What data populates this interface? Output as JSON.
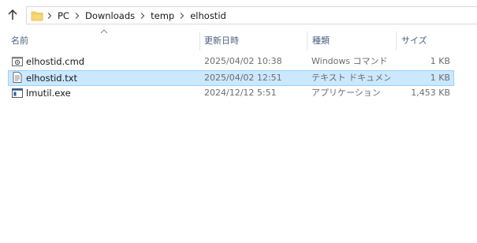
{
  "address_bar": {
    "crumbs": [
      "PC",
      "Downloads",
      "temp",
      "elhostid"
    ]
  },
  "columns": {
    "name": "名前",
    "date": "更新日時",
    "type": "種類",
    "size": "サイズ"
  },
  "files": [
    {
      "name": "elhostid.cmd",
      "date": "2025/04/02 10:38",
      "type": "Windows コマンド ...",
      "size": "1 KB",
      "icon": "cmd-file-icon",
      "selected": false
    },
    {
      "name": "elhostid.txt",
      "date": "2025/04/02 12:51",
      "type": "テキスト ドキュメント",
      "size": "1 KB",
      "icon": "text-file-icon",
      "selected": true
    },
    {
      "name": "lmutil.exe",
      "date": "2024/12/12 5:51",
      "type": "アプリケーション",
      "size": "1,453 KB",
      "icon": "exe-file-icon",
      "selected": false
    }
  ],
  "colors": {
    "selection_bg": "#cce8ff",
    "selection_border": "#99d1ff",
    "header_text": "#4d6082",
    "folder_yellow": "#f8d775"
  }
}
